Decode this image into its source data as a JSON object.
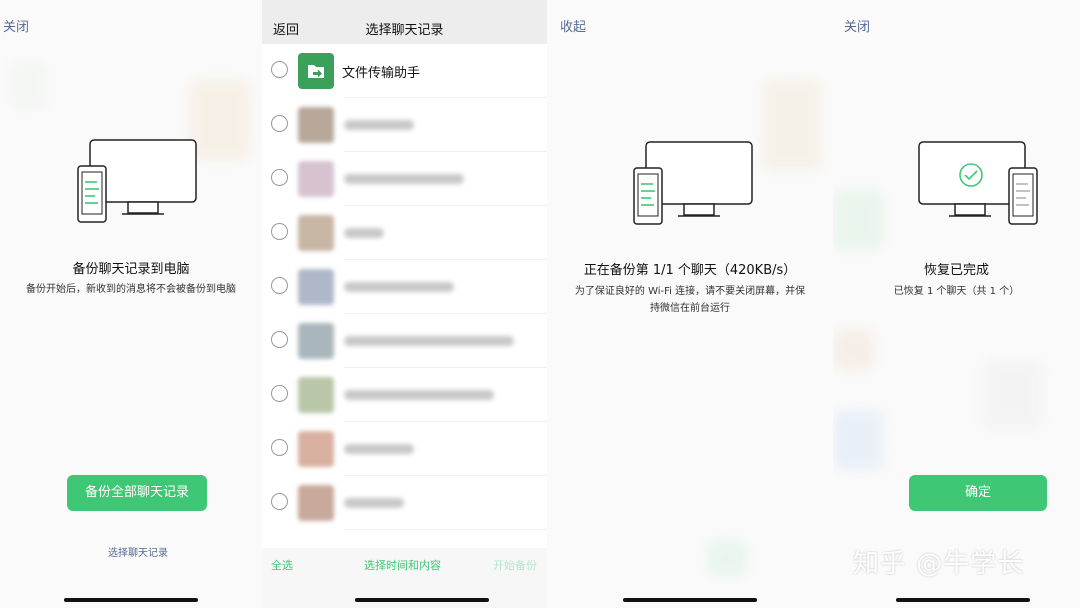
{
  "colors": {
    "accent": "#3ec876",
    "link": "#576b95",
    "text": "#111111"
  },
  "panel1": {
    "top_button": "关闭",
    "title": "备份聊天记录到电脑",
    "subtitle": "备份开始后，新收到的消息将不会被备份到电脑",
    "primary_button": "备份全部聊天记录",
    "link": "选择聊天记录",
    "icon": "monitor-phone-icon"
  },
  "panel2": {
    "back": "返回",
    "title": "选择聊天记录",
    "items": [
      {
        "name": "文件传输助手",
        "icon": "file-transfer-icon"
      },
      {
        "name": ""
      },
      {
        "name": ""
      },
      {
        "name": ""
      },
      {
        "name": ""
      },
      {
        "name": ""
      },
      {
        "name": ""
      },
      {
        "name": ""
      },
      {
        "name": ""
      }
    ],
    "footer": {
      "select_all": "全选",
      "select_time": "选择时间和内容",
      "start_backup": "开始备份"
    }
  },
  "panel3": {
    "top_button": "收起",
    "title": "正在备份第 1/1 个聊天（420KB/s）",
    "subtitle_line1": "为了保证良好的 Wi-Fi 连接，请不要关闭屏幕，并保",
    "subtitle_line2": "持微信在前台运行",
    "icon": "monitor-phone-icon"
  },
  "panel4": {
    "top_button": "关闭",
    "title": "恢复已完成",
    "subtitle": "已恢复 1 个聊天（共 1 个）",
    "primary_button": "确定",
    "icon": "monitor-check-icon"
  },
  "watermark": "知乎 @牛学长"
}
